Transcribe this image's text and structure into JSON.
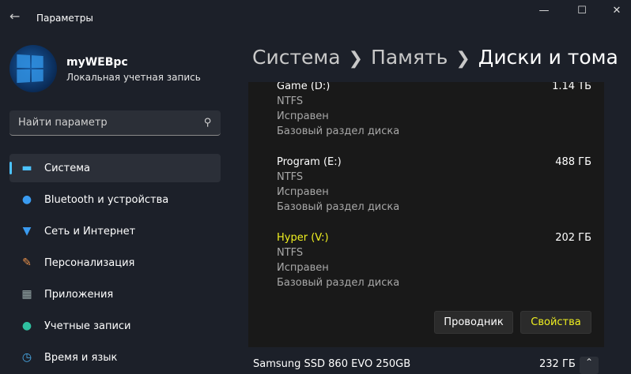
{
  "window": {
    "title": "Параметры"
  },
  "user": {
    "name": "myWEBpc",
    "account_type": "Локальная учетная запись"
  },
  "search": {
    "placeholder": "Найти параметр"
  },
  "nav": [
    {
      "label": "Система",
      "icon": "monitor-icon",
      "selected": true
    },
    {
      "label": "Bluetooth и устройства",
      "icon": "bluetooth-icon"
    },
    {
      "label": "Сеть и Интернет",
      "icon": "wifi-icon"
    },
    {
      "label": "Персонализация",
      "icon": "brush-icon"
    },
    {
      "label": "Приложения",
      "icon": "apps-icon"
    },
    {
      "label": "Учетные записи",
      "icon": "person-icon"
    },
    {
      "label": "Время и язык",
      "icon": "clock-globe-icon"
    }
  ],
  "breadcrumb": [
    "Система",
    "Память",
    "Диски и тома"
  ],
  "volumes": [
    {
      "name": "Game (D:)",
      "size": "1.14 ТБ",
      "fs": "NTFS",
      "status": "Исправен",
      "type": "Базовый раздел диска"
    },
    {
      "name": "Program (E:)",
      "size": "488 ГБ",
      "fs": "NTFS",
      "status": "Исправен",
      "type": "Базовый раздел диска"
    },
    {
      "name": "Hyper (V:)",
      "size": "202 ГБ",
      "fs": "NTFS",
      "status": "Исправен",
      "type": "Базовый раздел диска"
    }
  ],
  "buttons": {
    "explorer": "Проводник",
    "properties": "Свойства"
  },
  "disk": {
    "name": "Samsung SSD 860 EVO 250GB",
    "size": "232 ГБ"
  },
  "colors": {
    "accent": "#4cc2ff",
    "highlight": "#f0f020"
  }
}
